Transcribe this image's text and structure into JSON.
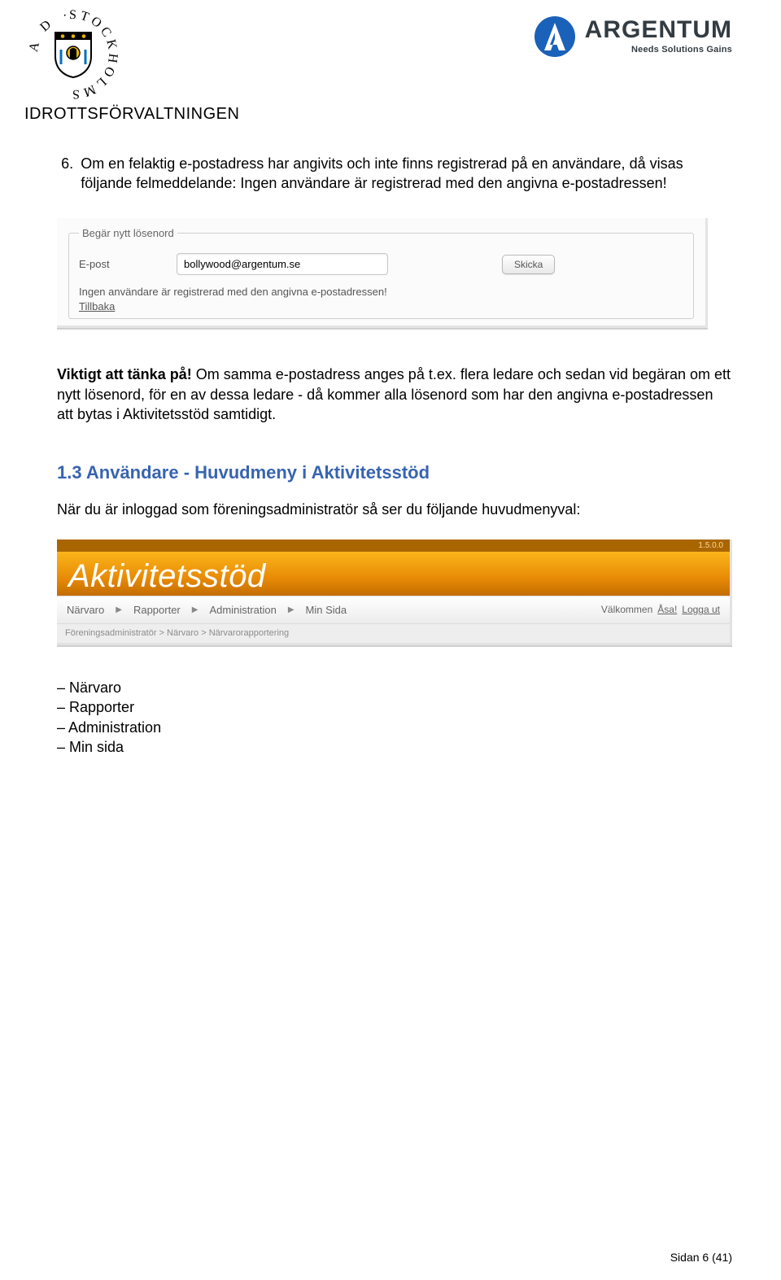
{
  "header": {
    "left_logo_ring_text": "STOCKHOLMS · STAD ·",
    "subheader": "IDROTTSFÖRVALTNINGEN",
    "right_logo_name": "ARGENTUM",
    "right_logo_tagline": "Needs  Solutions  Gains"
  },
  "body": {
    "numbered_item": "Om en felaktig e-postadress har angivits och inte finns registrerad på en användare, då visas följande felmeddelande: Ingen användare är registrerad med den angivna e-postadressen!",
    "important_bold": "Viktigt att tänka på!",
    "important_rest": " Om samma e-postadress anges på t.ex. flera ledare och sedan vid begäran om ett nytt lösenord, för en av dessa ledare - då kommer alla lösenord som har den angivna e-postadressen att bytas i Aktivitetsstöd samtidigt.",
    "section_title": "1.3 Användare - Huvudmeny i Aktivitetsstöd",
    "section_text": "När du är inloggad som föreningsadministratör så ser du följande huvudmenyval:"
  },
  "screenshot1": {
    "legend": "Begär nytt lösenord",
    "label": "E-post",
    "email_value": "bollywood@argentum.se",
    "button": "Skicka",
    "error": "Ingen användare är registrerad med den angivna e-postadressen!",
    "back_link": "Tillbaka"
  },
  "screenshot2": {
    "version": "1.5.0.0",
    "banner_title": "Aktivitetsstöd",
    "menu_items": [
      "Närvaro",
      "Rapporter",
      "Administration",
      "Min Sida"
    ],
    "welcome_prefix": "Välkommen ",
    "welcome_user": "Åsa!",
    "logout": "Logga ut",
    "crumbs": "Föreningsadministratör > Närvaro > Närvarorapportering"
  },
  "dash_items": [
    "Närvaro",
    "Rapporter",
    "Administration",
    "Min sida"
  ],
  "footer": {
    "page": "Sidan 6 (41)"
  }
}
